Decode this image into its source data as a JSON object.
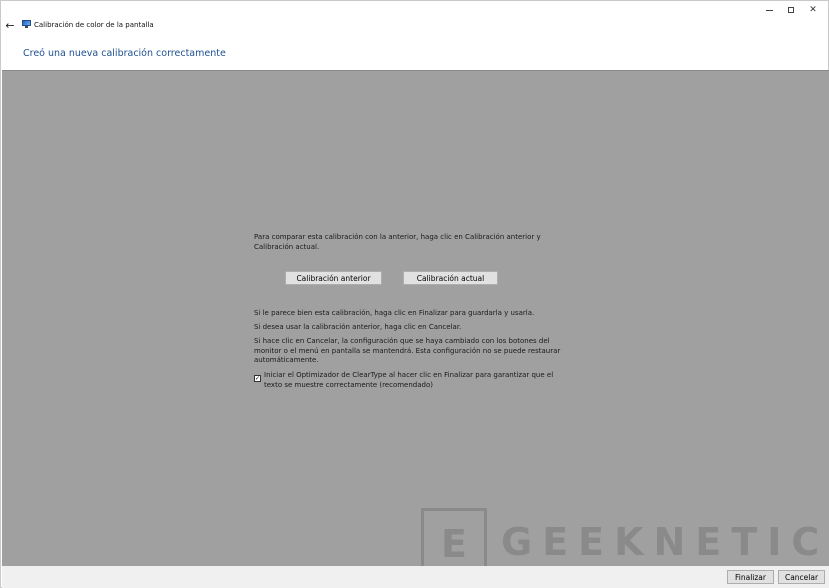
{
  "window": {
    "title": "Calibración de color de la pantalla",
    "back_icon": "arrow-left-icon",
    "app_icon": "monitor-icon"
  },
  "header": {
    "heading": "Creó una nueva calibración correctamente"
  },
  "main": {
    "compare_text": "Para comparar esta calibración con la anterior, haga clic en Calibración anterior y Calibración actual.",
    "buttons": {
      "previous": "Calibración anterior",
      "current": "Calibración actual"
    },
    "info_finish": "Si le parece bien esta calibración, haga clic en Finalizar para guardarla y usarla.",
    "info_cancel": "Si desea usar la calibración anterior, haga clic en Cancelar.",
    "info_restore": "Si hace clic en Cancelar, la configuración que se haya cambiado con los botones del monitor o el menú en pantalla se mantendrá. Esta configuración no se puede restaurar automáticamente.",
    "cleartype": {
      "checked": true,
      "label": "Iniciar el Optimizador de ClearType al hacer clic en Finalizar para garantizar que el texto se muestre correctamente (recomendado)"
    }
  },
  "watermark": {
    "logo_letter": "E",
    "text": "GEEKNETIC"
  },
  "footer": {
    "finish": "Finalizar",
    "cancel": "Cancelar"
  },
  "colors": {
    "heading": "#1e4f91",
    "content_bg": "#a0a0a0",
    "footer_bg": "#f0f0f0"
  }
}
